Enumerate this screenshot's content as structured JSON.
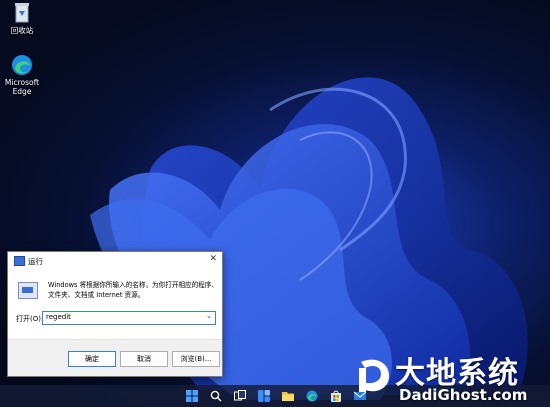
{
  "desktop": {
    "icons": [
      {
        "label": "回收站",
        "icon": "recycle-bin-icon"
      },
      {
        "label": "Microsoft Edge",
        "icon": "edge-icon"
      }
    ]
  },
  "run_dialog": {
    "title": "运行",
    "close": "✕",
    "description": "Windows 将根据你所输入的名称，为你打开相应的程序、文件夹、文档或 Internet 资源。",
    "open_label": "打开(O):",
    "open_value": "regedit",
    "ok_label": "确定",
    "cancel_label": "取消",
    "browse_label": "浏览(B)..."
  },
  "taskbar": {
    "icons": [
      "start-icon",
      "search-icon",
      "task-view-icon",
      "widgets-icon",
      "file-explorer-icon",
      "edge-icon",
      "store-icon",
      "mail-icon"
    ]
  },
  "watermark": {
    "brand_cn": "大地系统",
    "brand_en": "DadiGhost.com"
  },
  "colors": {
    "accent": "#3c7fd4",
    "wallpaper_blue": "#1b3fbf"
  }
}
